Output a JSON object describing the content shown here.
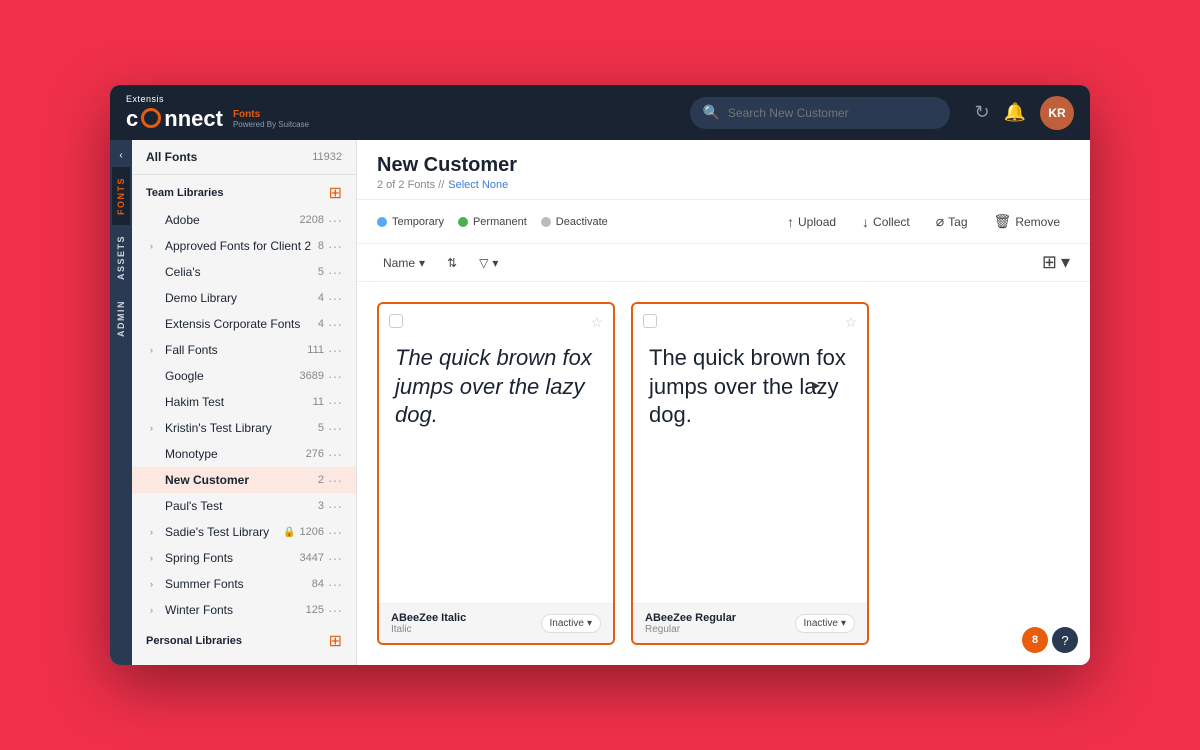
{
  "header": {
    "extensis_label": "Extensis",
    "connect_label": "connect",
    "powered_fonts": "Fonts",
    "powered_by": "Powered By Suitcase",
    "search_placeholder": "Search New Customer",
    "avatar_initials": "KR"
  },
  "side_tabs": {
    "arrow_label": "‹",
    "tabs": [
      {
        "id": "fonts",
        "label": "FONTS",
        "active": true
      },
      {
        "id": "assets",
        "label": "ASSETS",
        "active": false
      },
      {
        "id": "admin",
        "label": "ADMIN",
        "active": false
      }
    ]
  },
  "sidebar": {
    "all_fonts_label": "All Fonts",
    "all_fonts_count": "11932",
    "team_libraries_label": "Team Libraries",
    "personal_libraries_label": "Personal Libraries",
    "add_button": "+",
    "libraries": [
      {
        "id": "adobe",
        "name": "Adobe",
        "count": "2208",
        "expandable": false
      },
      {
        "id": "approved-fonts",
        "name": "Approved Fonts for Client 2",
        "count": "8",
        "expandable": true
      },
      {
        "id": "celias",
        "name": "Celia's",
        "count": "5",
        "expandable": false
      },
      {
        "id": "demo-library",
        "name": "Demo Library",
        "count": "4",
        "expandable": false
      },
      {
        "id": "extensis-corporate",
        "name": "Extensis Corporate Fonts",
        "count": "4",
        "expandable": false
      },
      {
        "id": "fall-fonts",
        "name": "Fall Fonts",
        "count": "111",
        "expandable": true
      },
      {
        "id": "google",
        "name": "Google",
        "count": "3689",
        "expandable": false
      },
      {
        "id": "hakim-test",
        "name": "Hakim Test",
        "count": "11",
        "expandable": false
      },
      {
        "id": "kristins-test",
        "name": "Kristin's Test Library",
        "count": "5",
        "expandable": true
      },
      {
        "id": "monotype",
        "name": "Monotype",
        "count": "276",
        "expandable": false
      },
      {
        "id": "new-customer",
        "name": "New Customer",
        "count": "2",
        "expandable": false,
        "active": true
      },
      {
        "id": "pauls-test",
        "name": "Paul's Test",
        "count": "3",
        "expandable": false
      },
      {
        "id": "sadies-test",
        "name": "Sadie's Test Library",
        "count": "1206",
        "expandable": true,
        "lock": true
      },
      {
        "id": "spring-fonts",
        "name": "Spring Fonts",
        "count": "3447",
        "expandable": true
      },
      {
        "id": "summer-fonts",
        "name": "Summer Fonts",
        "count": "84",
        "expandable": true
      },
      {
        "id": "winter-fonts",
        "name": "Winter Fonts",
        "count": "125",
        "expandable": true
      }
    ]
  },
  "content": {
    "title": "New Customer",
    "subtitle_count": "2 of 2 Fonts //",
    "subtitle_select": "Select None",
    "status_indicators": [
      {
        "id": "temporary",
        "label": "Temporary",
        "color_class": "dot-temp"
      },
      {
        "id": "permanent",
        "label": "Permanent",
        "color_class": "dot-perm"
      },
      {
        "id": "deactivate",
        "label": "Deactivate",
        "color_class": "dot-deact"
      }
    ],
    "actions": [
      {
        "id": "upload",
        "label": "Upload",
        "icon": "↑"
      },
      {
        "id": "collect",
        "label": "Collect",
        "icon": "↓"
      },
      {
        "id": "tag",
        "label": "Tag",
        "icon": "🏷"
      },
      {
        "id": "remove",
        "label": "Remove",
        "icon": "🗑"
      }
    ],
    "filters": {
      "name_label": "Name",
      "sort_icon": "⇅",
      "filter_icon": "▿"
    },
    "font_cards": [
      {
        "id": "abeezee-italic",
        "preview_text": "The quick brown fox jumps over the lazy dog.",
        "italic": true,
        "font_name": "ABeeZee Italic",
        "font_style": "Italic",
        "status": "Inactive"
      },
      {
        "id": "abeezee-regular",
        "preview_text": "The quick brown fox jumps over the lazy dog.",
        "italic": false,
        "font_name": "ABeeZee Regular",
        "font_style": "Regular",
        "status": "Inactive"
      }
    ]
  },
  "bottom": {
    "help_count": "8",
    "help_label": "?"
  }
}
